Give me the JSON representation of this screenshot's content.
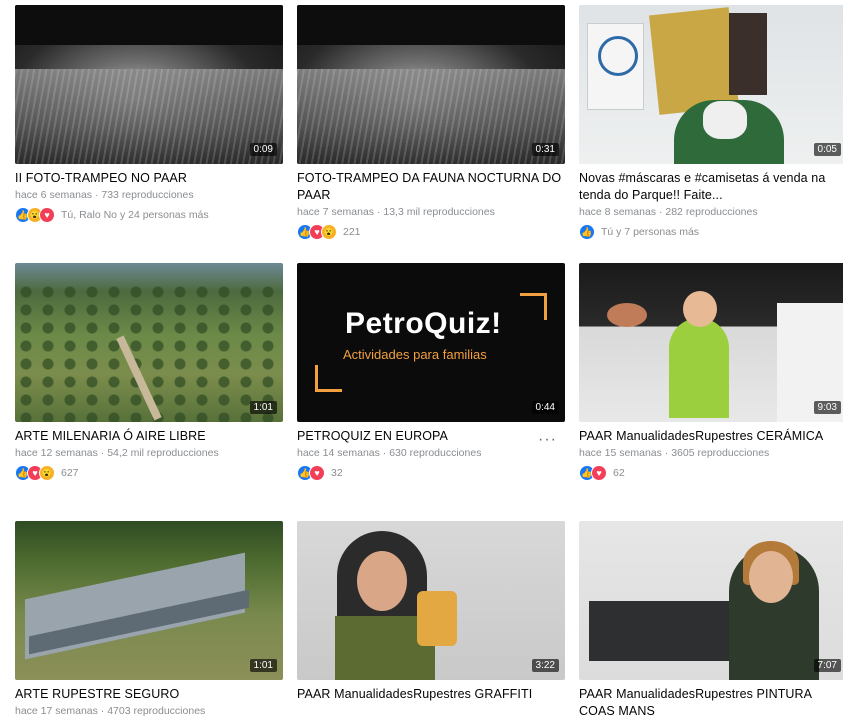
{
  "videos": [
    {
      "title": "II FOTO-TRAMPEO NO PAAR",
      "meta": "hace 6 semanas · 733 reproducciones",
      "duration": "0:09",
      "reaction_text": "Tú, Ralo No y 24 personas más",
      "reactions": [
        "like-icon",
        "wow-icon",
        "love-icon"
      ]
    },
    {
      "title": "FOTO-TRAMPEO DA FAUNA NOCTURNA DO PAAR",
      "meta": "hace 7 semanas · 13,3 mil reproducciones",
      "duration": "0:31",
      "reaction_text": "221",
      "reactions": [
        "like-icon",
        "love-icon",
        "wow-icon"
      ]
    },
    {
      "title": "Novas #máscaras e #camisetas á venda na tenda do Parque!! Faite...",
      "meta": "hace 8 semanas · 282 reproducciones",
      "duration": "0:05",
      "reaction_text": "Tú y 7 personas más",
      "reactions": [
        "like-icon"
      ]
    },
    {
      "title": "ARTE MILENARIA Ó AIRE LIBRE",
      "meta": "hace 12 semanas · 54,2 mil reproducciones",
      "duration": "1:01",
      "reaction_text": "627",
      "reactions": [
        "like-icon",
        "love-icon",
        "wow-icon"
      ]
    },
    {
      "title": "PETROQUIZ EN EUROPA",
      "meta": "hace 14 semanas · 630 reproducciones",
      "duration": "0:44",
      "reaction_text": "32",
      "reactions": [
        "like-icon",
        "love-icon"
      ]
    },
    {
      "title": "PAAR ManualidadesRupestres CERÁMICA",
      "meta": "hace 15 semanas · 3605 reproducciones",
      "duration": "9:03",
      "reaction_text": "62",
      "reactions": [
        "like-icon",
        "love-icon"
      ]
    },
    {
      "title": "ARTE RUPESTRE SEGURO",
      "meta": "hace 17 semanas · 4703 reproducciones",
      "duration": "1:01",
      "reaction_text": "",
      "reactions": []
    },
    {
      "title": "PAAR ManualidadesRupestres GRAFFITI",
      "meta": "",
      "duration": "3:22",
      "reaction_text": "",
      "reactions": []
    },
    {
      "title": "PAAR ManualidadesRupestres PINTURA COAS MANS",
      "meta": "",
      "duration": "7:07",
      "reaction_text": "",
      "reactions": []
    }
  ],
  "quiz_thumb": {
    "title": "PetroQuiz!",
    "subtitle": "Actividades para familias"
  },
  "more_options": "···",
  "colors": {
    "like": "#1877f2",
    "love": "#f33e58",
    "wow": "#f7b125",
    "meta": "#8a8d91"
  }
}
